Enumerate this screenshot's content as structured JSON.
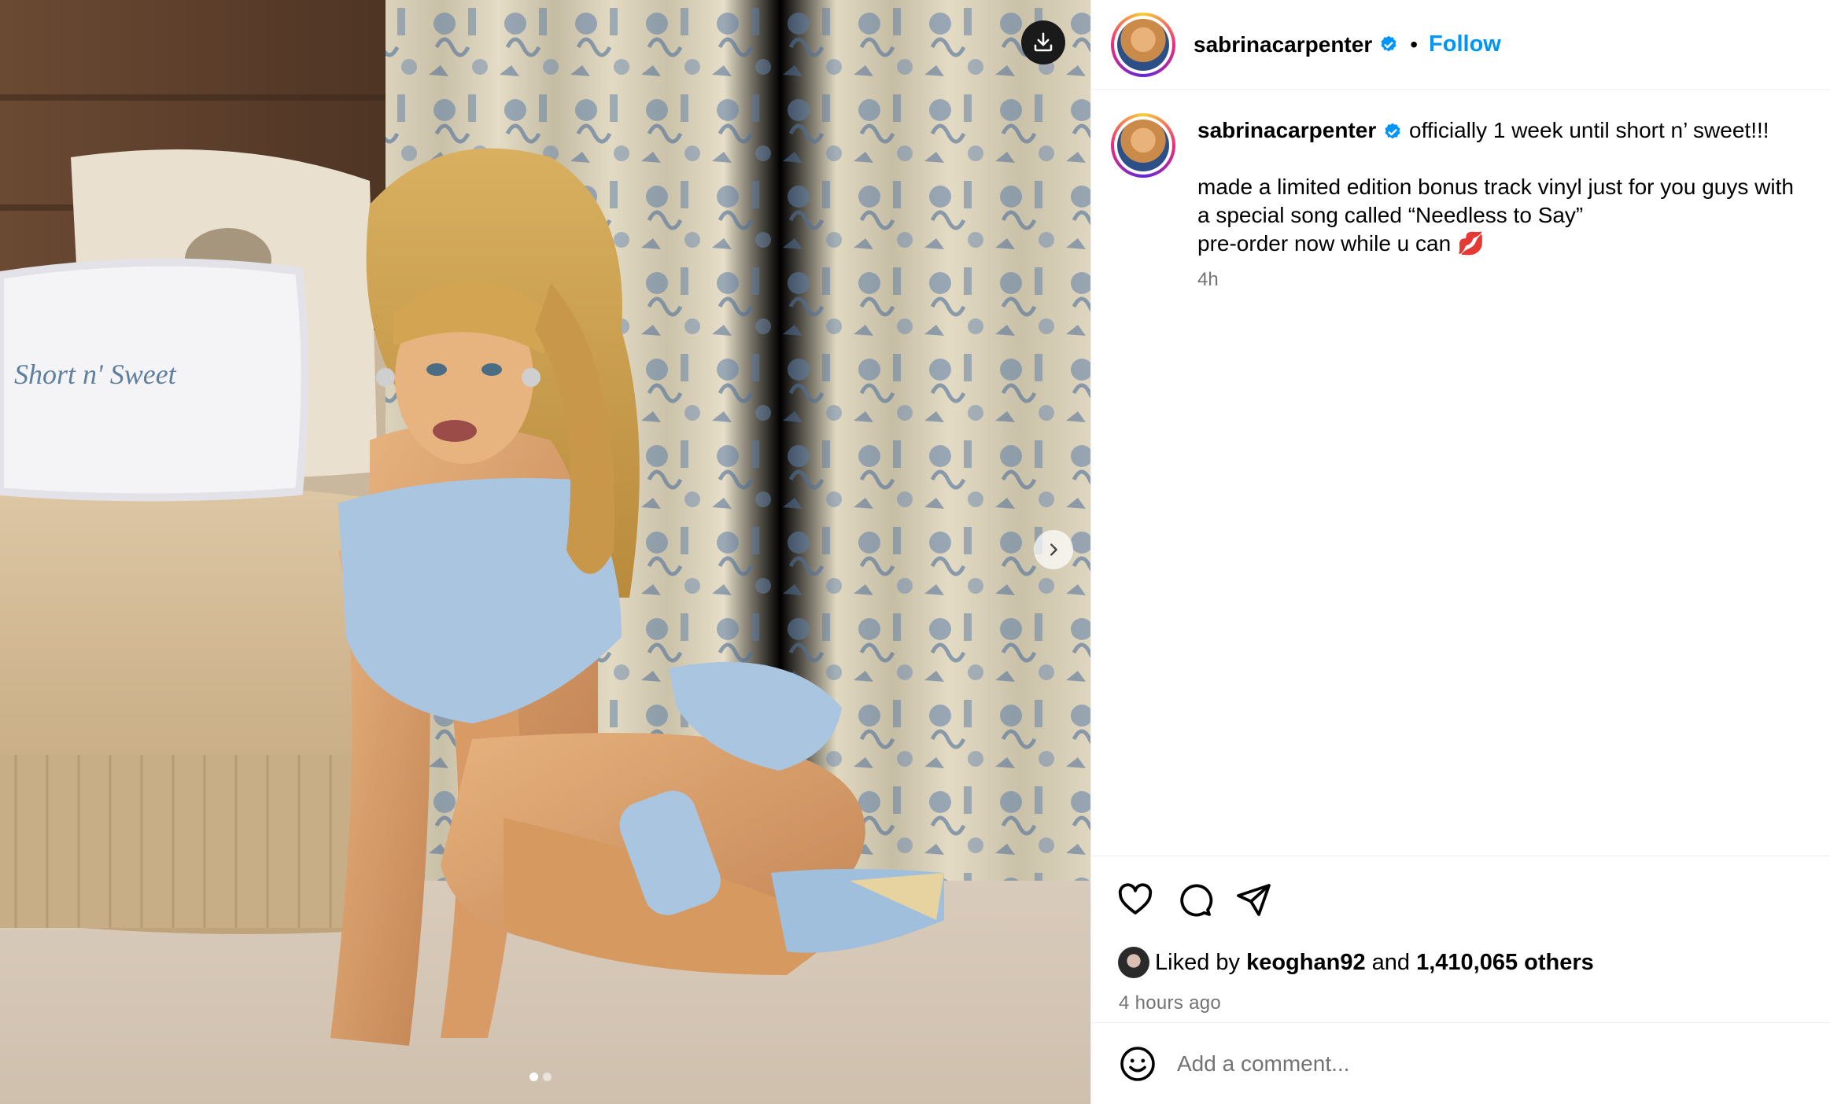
{
  "post": {
    "username": "sabrinacarpenter",
    "follow_label": "Follow",
    "separator": "•",
    "caption_first": "officially 1 week until short n’ sweet!!!",
    "caption_lines": [
      "made a limited edition bonus track vinyl just for you guys with",
      "a special song called “Needless to Say”",
      "pre-order now while u can 💋"
    ],
    "caption_time": "4h",
    "pillow_text": "Short n' Sweet"
  },
  "engagement": {
    "liked_by_prefix": "Liked by",
    "liked_by_user": "keoghan92",
    "and_word": "and",
    "others": "1,410,065 others",
    "time_ago": "4 hours ago"
  },
  "comment": {
    "placeholder": "Add a comment..."
  },
  "carousel": {
    "total_slides": 2,
    "current_slide": 1
  },
  "icons": {
    "download": "download-icon",
    "next": "chevron-right-icon",
    "like": "heart-icon",
    "comment": "comment-icon",
    "share": "paper-plane-icon",
    "emoji": "smiley-icon",
    "verified": "verified-badge-icon"
  },
  "colors": {
    "accent_blue": "#0095f6",
    "verified_blue": "#0095f6",
    "muted_text": "#737373",
    "divider": "#efefef"
  }
}
